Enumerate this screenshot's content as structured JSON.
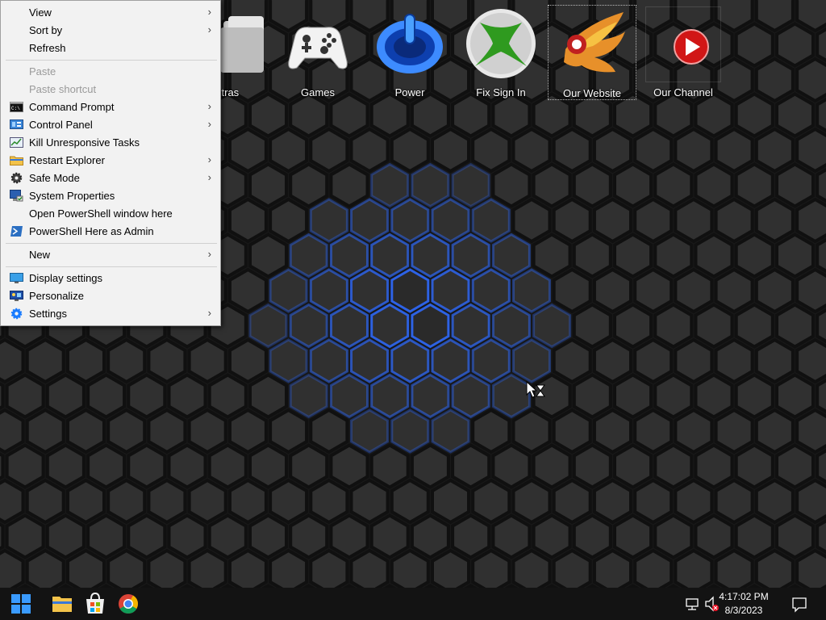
{
  "desktop": {
    "icons": [
      {
        "label": "Extras",
        "visible_label": "xtras"
      },
      {
        "label": "Games"
      },
      {
        "label": "Power"
      },
      {
        "label": "Fix Sign In"
      },
      {
        "label": "Our Website"
      },
      {
        "label": "Our Channel"
      }
    ]
  },
  "context_menu": {
    "items": [
      {
        "label": "View",
        "submenu": true,
        "enabled": true
      },
      {
        "label": "Sort by",
        "submenu": true,
        "enabled": true
      },
      {
        "label": "Refresh",
        "enabled": true
      },
      {
        "label": "Paste",
        "enabled": false
      },
      {
        "label": "Paste shortcut",
        "enabled": false
      },
      {
        "label": "Command Prompt",
        "submenu": true,
        "icon": "command-prompt-icon"
      },
      {
        "label": "Control Panel",
        "submenu": true,
        "icon": "control-panel-icon"
      },
      {
        "label": "Kill Unresponsive Tasks",
        "icon": "task-manager-icon"
      },
      {
        "label": "Restart Explorer",
        "submenu": true,
        "icon": "folder-icon"
      },
      {
        "label": "Safe Mode",
        "submenu": true,
        "icon": "gear-icon"
      },
      {
        "label": "System Properties",
        "icon": "system-properties-icon"
      },
      {
        "label": "Open PowerShell window here"
      },
      {
        "label": "PowerShell Here as Admin",
        "icon": "powershell-icon"
      },
      {
        "label": "New",
        "submenu": true
      },
      {
        "label": "Display settings",
        "icon": "display-icon"
      },
      {
        "label": "Personalize",
        "icon": "personalize-icon"
      },
      {
        "label": "Settings",
        "submenu": true,
        "icon": "settings-gear-icon"
      }
    ],
    "submenu_arrow": "›"
  },
  "taskbar": {
    "apps": [
      "start-icon",
      "file-explorer-icon",
      "store-icon",
      "chrome-icon"
    ],
    "tray": {
      "icons": [
        "network-icon",
        "volume-muted-icon"
      ],
      "time": "4:17:02 PM",
      "date": "8/3/2023"
    }
  },
  "colors": {
    "menu_bg": "#f2f2f2",
    "taskbar_bg": "#131313",
    "hex_glow": "#2f6bff",
    "accent_blue": "#1a7cff"
  }
}
